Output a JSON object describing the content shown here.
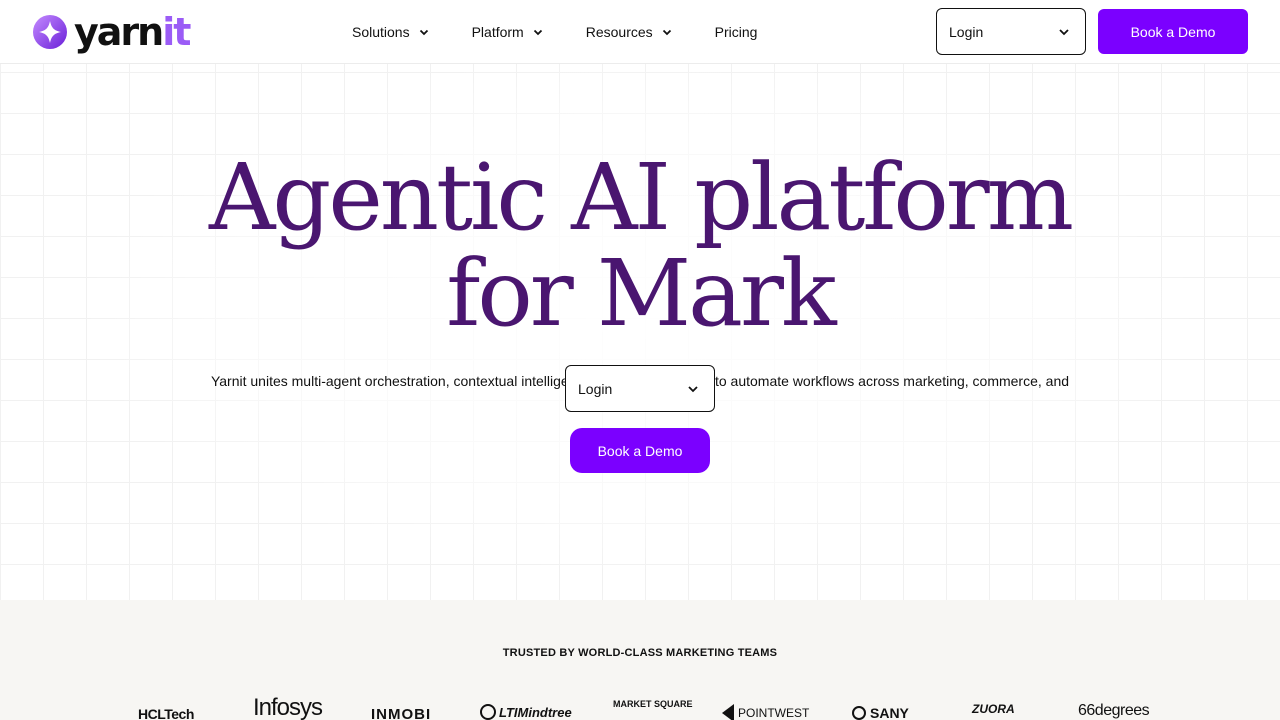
{
  "brand": {
    "name_main": "yarn",
    "name_accent": "it",
    "accent_color": "#9b5cf6",
    "primary_color": "#7b00ff",
    "headline_color": "#4a1670"
  },
  "nav": {
    "items": [
      {
        "label": "Solutions",
        "icon": "chevron-down-icon"
      },
      {
        "label": "Platform",
        "icon": "chevron-down-icon"
      },
      {
        "label": "Resources",
        "icon": "chevron-down-icon"
      },
      {
        "label": "Pricing"
      }
    ]
  },
  "header": {
    "login_label": "Login",
    "demo_label": "Book a Demo"
  },
  "hero": {
    "headline_line1": "Agentic AI platform",
    "headline_line2": "for Mark",
    "subtitle": "Yarnit unites multi-agent orchestration, contextual intelligence, and pre-built apps to automate workflows across marketing, commerce, and enterprise operations.",
    "login_label": "Login",
    "demo_label": "Book a Demo"
  },
  "trusted": {
    "title": "TRUSTED BY WORLD-CLASS MARKETING TEAMS",
    "logos": [
      "HCLTech",
      "Infosys",
      "INMOBI",
      "LTIMindtree",
      "MARKET SQUARE",
      "POINTWEST",
      "SANY",
      "ZUORA",
      "66degrees"
    ]
  }
}
